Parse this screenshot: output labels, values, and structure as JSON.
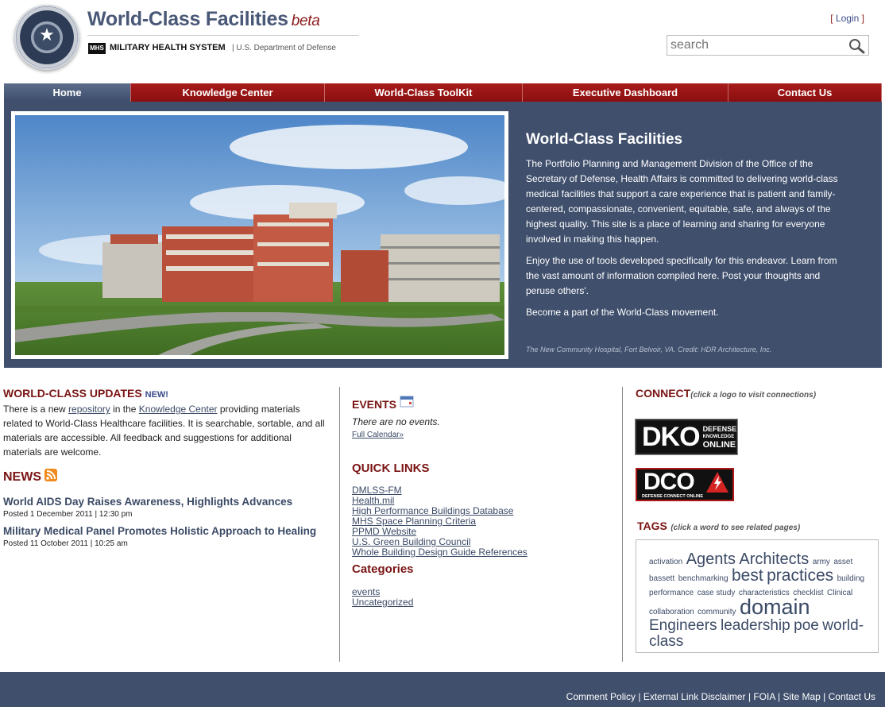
{
  "header": {
    "title": "World-Class Facilities",
    "beta": "beta",
    "mhs_badge": "MHS",
    "mhs_name": "MILITARY HEALTH SYSTEM",
    "department": "| U.S. Department of Defense",
    "login_open": "[",
    "login": "Login",
    "login_close": "]",
    "search_placeholder": "search"
  },
  "nav": {
    "items": [
      {
        "label": "Home",
        "active": true
      },
      {
        "label": "Knowledge Center"
      },
      {
        "label": "World-Class ToolKit"
      },
      {
        "label": "Executive Dashboard"
      },
      {
        "label": "Contact Us"
      }
    ]
  },
  "hero": {
    "title": "World-Class Facilities",
    "p1": "The Portfolio Planning and Management Division of the Office of the Secretary of Defense, Health Affairs is committed to delivering world-class medical facilities that support a care experience that is patient and family-centered, compassionate, convenient, equitable, safe, and always of the highest quality. This site is a place of learning and sharing for everyone involved in making this happen.",
    "p2": "Enjoy the use of tools developed specifically for this endeavor. Learn from the vast amount of information compiled here. Post your thoughts and peruse others'.",
    "p3": "Become a part of the World-Class movement.",
    "caption": "The New Community Hospital, Fort Belvoir, VA. Credit: HDR Architecture, Inc."
  },
  "updates": {
    "heading": "WORLD-CLASS UPDATES",
    "new_tag": "NEW!",
    "text_1": "There is a new",
    "link_1": "repository",
    "text_2": "in the",
    "link_2": "Knowledge Center",
    "text_3": "providing materials related to World-Class Healthcare facilities. It is searchable, sortable, and all materials are accessible. All feedback and suggestions for additional materials are welcome."
  },
  "news": {
    "heading": "NEWS",
    "items": [
      {
        "title": "World AIDS Day Raises Awareness, Highlights Advances",
        "meta": "Posted 1 December 2011 | 12:30 pm"
      },
      {
        "title": "Military Medical Panel Promotes Holistic Approach to Healing",
        "meta": "Posted 11 October 2011 | 10:25 am"
      }
    ]
  },
  "events": {
    "heading": "EVENTS",
    "empty": "There are no events.",
    "calendar_link": "Full Calendar»"
  },
  "quick_links": {
    "heading": "QUICK LINKS",
    "items": [
      "DMLSS-FM",
      "Health.mil",
      "High Performance Buildings Database",
      "MHS Space Planning Criteria",
      "PPMD Website",
      "U.S. Green Building Council",
      "Whole Building Design Guide References"
    ]
  },
  "categories": {
    "heading": "Categories",
    "items": [
      "events",
      "Uncategorized"
    ]
  },
  "connect": {
    "heading": "CONNECT",
    "note": "(click a logo to visit connections)",
    "dko_big": "DKO",
    "dko_l1": "DEFENSE",
    "dko_l2": "KNOWLEDGE",
    "dko_l3": "ONLINE",
    "dco_big": "DCO",
    "dco_small": "DEFENSE CONNECT ONLINE"
  },
  "tags": {
    "heading": "TAGS",
    "note": "(click a word to see related pages)",
    "words": [
      {
        "text": "activation",
        "size": 10
      },
      {
        "text": "Agents",
        "size": 20
      },
      {
        "text": "Architects",
        "size": 20
      },
      {
        "text": "army",
        "size": 10
      },
      {
        "text": "asset",
        "size": 10
      },
      {
        "text": "bassett",
        "size": 10
      },
      {
        "text": "benchmarking",
        "size": 10
      },
      {
        "text": "best",
        "size": 21
      },
      {
        "text": "practices",
        "size": 21
      },
      {
        "text": "building performance",
        "size": 10
      },
      {
        "text": "case study",
        "size": 10
      },
      {
        "text": "characteristics",
        "size": 10
      },
      {
        "text": "checklist",
        "size": 10
      },
      {
        "text": "Clinical",
        "size": 10
      },
      {
        "text": "collaboration",
        "size": 10
      },
      {
        "text": "community",
        "size": 10
      },
      {
        "text": "domain",
        "size": 27
      },
      {
        "text": "Engineers",
        "size": 19
      },
      {
        "text": "leadership",
        "size": 19
      },
      {
        "text": "poe",
        "size": 19
      },
      {
        "text": "world-class",
        "size": 19
      }
    ]
  },
  "footer": {
    "links": [
      "Comment Policy",
      "External Link Disclaimer",
      "FOIA",
      "Site Map",
      "Contact Us"
    ],
    "separator": " | "
  },
  "colors": {
    "nav_red": "#8a0f0f",
    "nav_active": "#3d4d6b",
    "hero_bg": "#3f4f6c",
    "heading_red": "#7a1414",
    "link_blue": "#3b4a66"
  }
}
